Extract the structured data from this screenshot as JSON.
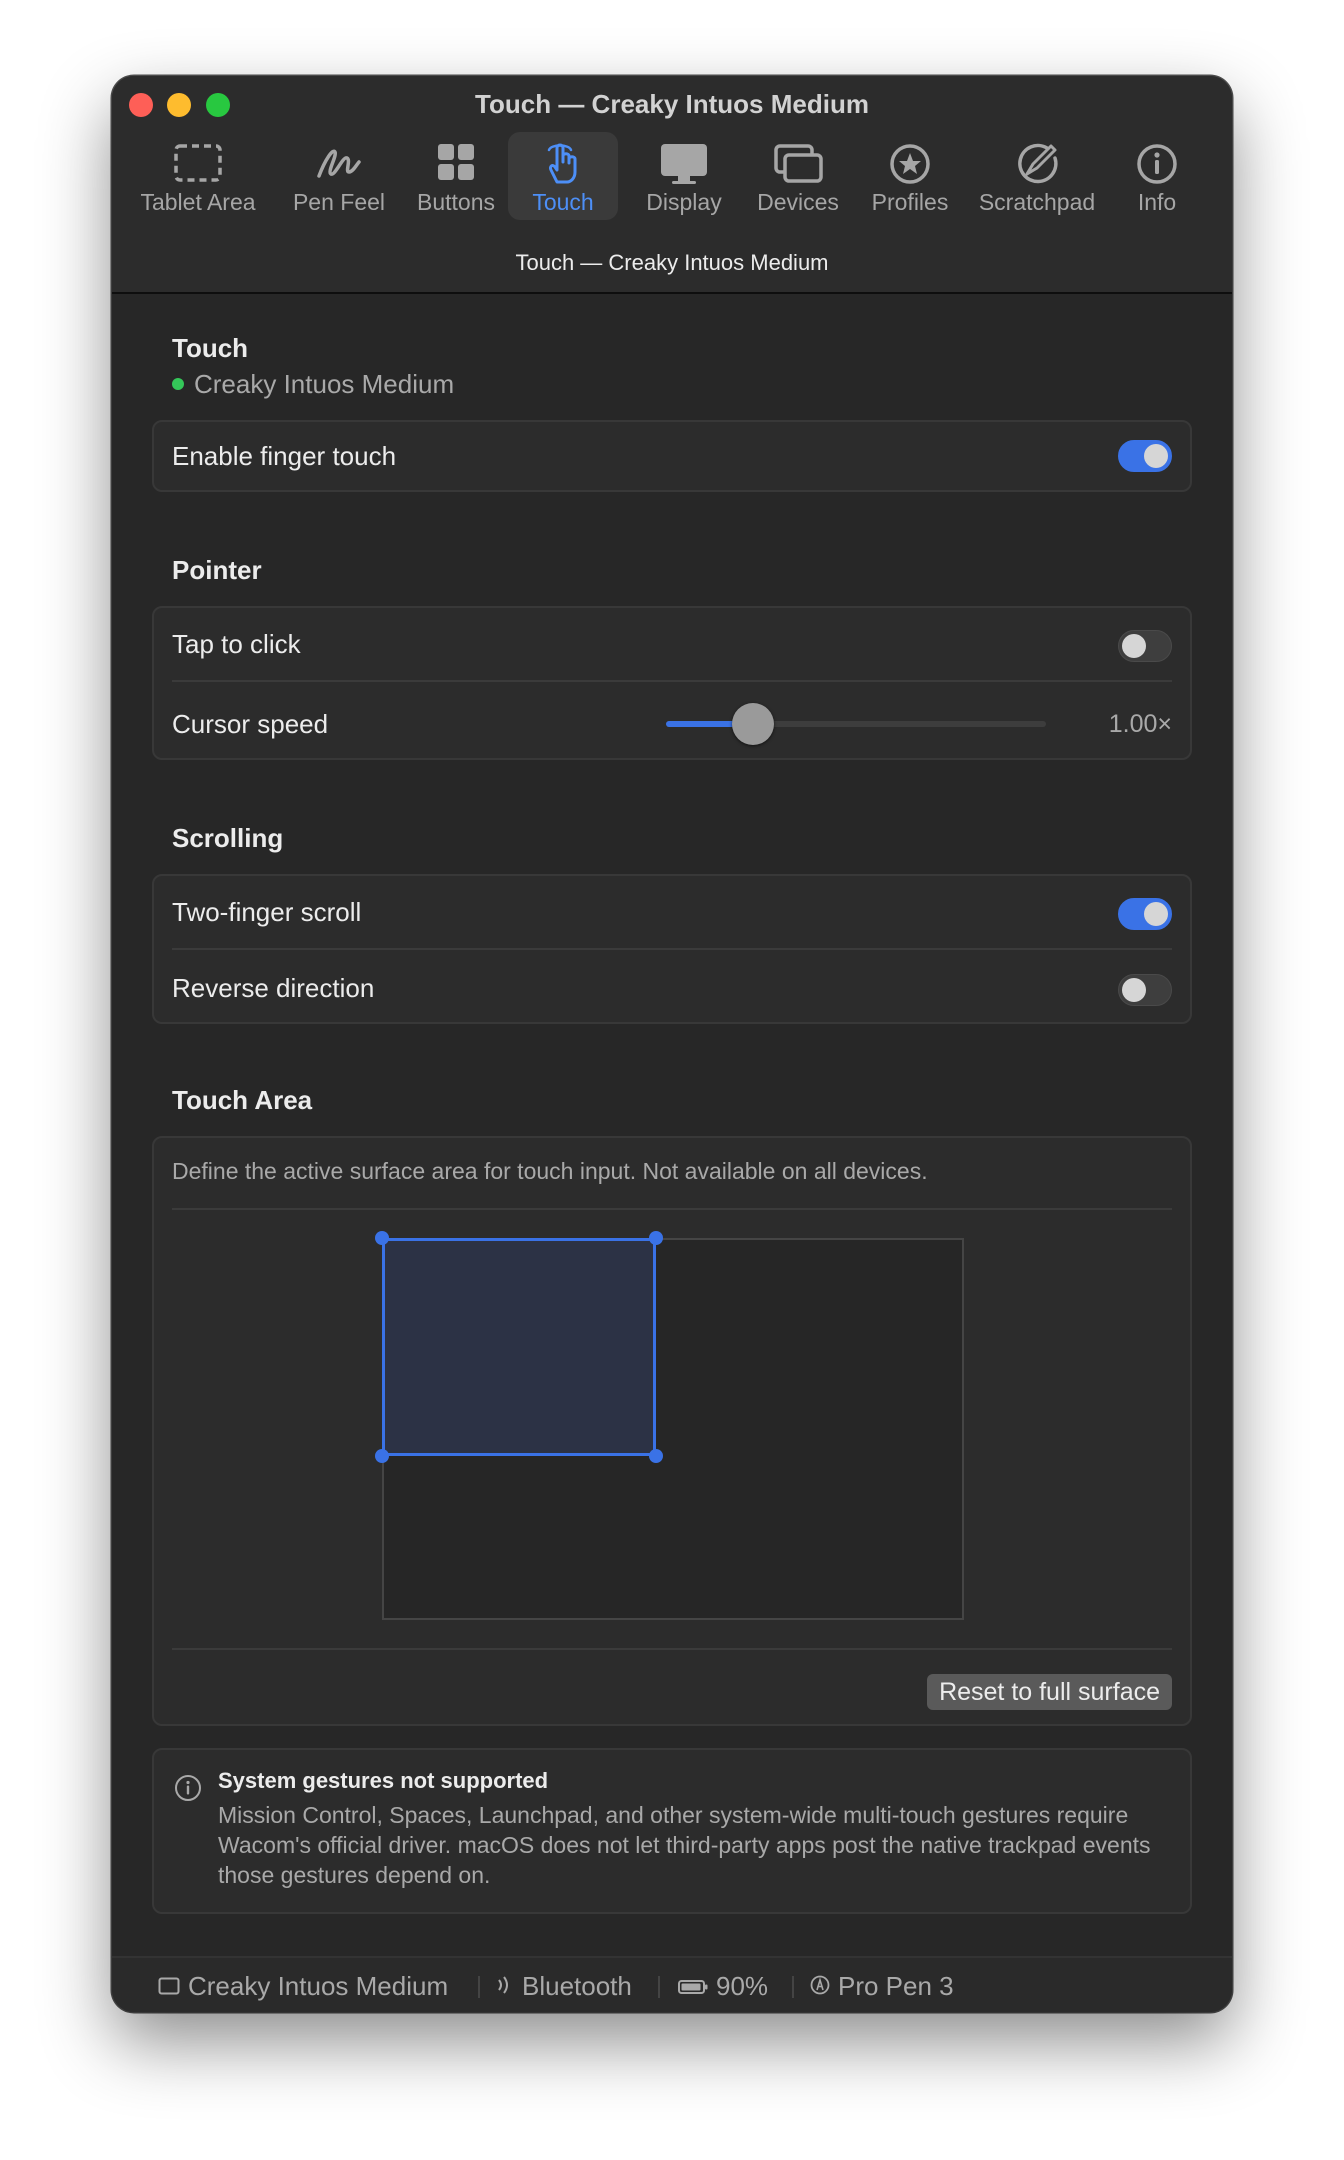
{
  "window": {
    "title": "Touch — Creaky Intuos Medium"
  },
  "toolbar": {
    "items": [
      {
        "label": "Tablet Area",
        "icon": "tablet-area-icon"
      },
      {
        "label": "Pen Feel",
        "icon": "pen-feel-icon"
      },
      {
        "label": "Buttons",
        "icon": "buttons-icon"
      },
      {
        "label": "Touch",
        "icon": "touch-icon",
        "active": true
      },
      {
        "label": "Display",
        "icon": "display-icon"
      },
      {
        "label": "Devices",
        "icon": "devices-icon"
      },
      {
        "label": "Profiles",
        "icon": "profiles-icon"
      },
      {
        "label": "Scratchpad",
        "icon": "scratchpad-icon"
      },
      {
        "label": "Info",
        "icon": "info-icon"
      }
    ]
  },
  "subtitle": "Touch — Creaky Intuos Medium",
  "touch": {
    "heading": "Touch",
    "device": "Creaky Intuos Medium",
    "enable_label": "Enable finger touch",
    "enable_on": true
  },
  "pointer": {
    "heading": "Pointer",
    "tap_label": "Tap to click",
    "tap_on": false,
    "speed_label": "Cursor speed",
    "speed_value": "1.00×",
    "speed_fraction": 0.23
  },
  "scrolling": {
    "heading": "Scrolling",
    "two_finger_label": "Two-finger scroll",
    "two_finger_on": true,
    "reverse_label": "Reverse direction",
    "reverse_on": false
  },
  "touch_area": {
    "heading": "Touch Area",
    "description": "Define the active surface area for touch input.  Not available on all devices.",
    "reset_label": "Reset to full surface"
  },
  "notice": {
    "title": "System gestures not supported",
    "body": "Mission Control, Spaces, Launchpad, and other system-wide multi-touch gestures require Wacom's official driver. macOS does not let third-party apps post the native trackpad events those gestures depend on."
  },
  "status": {
    "device": "Creaky Intuos Medium",
    "connection": "Bluetooth",
    "battery": "90%",
    "pen": "Pro Pen 3"
  },
  "colors": {
    "accent": "#3a72e6",
    "active_tab": "#4d8ff7",
    "connected": "#34c759"
  }
}
